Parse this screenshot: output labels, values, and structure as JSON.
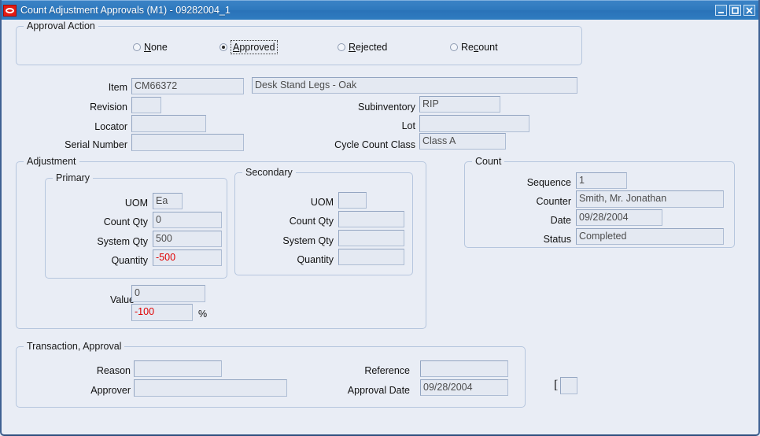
{
  "window": {
    "title": "Count Adjustment Approvals (M1) - 09282004_1",
    "icon": "oracle-logo-icon",
    "controls": {
      "minimize": "minimize-icon",
      "maximize": "maximize-icon",
      "close": "close-icon"
    },
    "accent_color": "#2e78bd",
    "background_color": "#e9edf5",
    "negative_value_color": "#e00000"
  },
  "approval_action": {
    "legend": "Approval Action",
    "options": [
      {
        "label": "None",
        "mnemonic": "N",
        "selected": false,
        "focused": false
      },
      {
        "label": "Approved",
        "mnemonic": "A",
        "selected": true,
        "focused": true
      },
      {
        "label": "Rejected",
        "mnemonic": "R",
        "selected": false,
        "focused": false
      },
      {
        "label": "Recount",
        "mnemonic": "c",
        "selected": false,
        "focused": false
      }
    ]
  },
  "item_section": {
    "item_label": "Item",
    "item_value": "CM66372",
    "item_description": "Desk Stand Legs - Oak",
    "revision_label": "Revision",
    "revision_value": "",
    "locator_label": "Locator",
    "locator_value": "",
    "serial_number_label": "Serial Number",
    "serial_number_value": "",
    "subinventory_label": "Subinventory",
    "subinventory_value": "RIP",
    "lot_label": "Lot",
    "lot_value": "",
    "cycle_count_class_label": "Cycle Count Class",
    "cycle_count_class_value": "Class A"
  },
  "adjustment": {
    "legend": "Adjustment",
    "primary": {
      "legend": "Primary",
      "uom_label": "UOM",
      "uom_value": "Ea",
      "count_qty_label": "Count Qty",
      "count_qty_value": "0",
      "system_qty_label": "System Qty",
      "system_qty_value": "500",
      "quantity_label": "Quantity",
      "quantity_value": "-500"
    },
    "secondary": {
      "legend": "Secondary",
      "uom_label": "UOM",
      "uom_value": "",
      "count_qty_label": "Count Qty",
      "count_qty_value": "",
      "system_qty_label": "System Qty",
      "system_qty_value": "",
      "quantity_label": "Quantity",
      "quantity_value": ""
    },
    "value_label": "Value",
    "value_amount": "0",
    "value_percent": "-100",
    "percent_sign": "%"
  },
  "count": {
    "legend": "Count",
    "sequence_label": "Sequence",
    "sequence_value": "1",
    "counter_label": "Counter",
    "counter_value": "Smith, Mr. Jonathan",
    "date_label": "Date",
    "date_value": "09/28/2004",
    "status_label": "Status",
    "status_value": "Completed"
  },
  "transaction_approval": {
    "legend": "Transaction, Approval",
    "reason_label": "Reason",
    "reason_value": "",
    "approver_label": "Approver",
    "approver_value": "",
    "reference_label": "Reference",
    "reference_value": "",
    "approval_date_label": "Approval Date",
    "approval_date_value": "09/28/2004",
    "flexfield_bracket": "[",
    "flexfield_value": ""
  }
}
